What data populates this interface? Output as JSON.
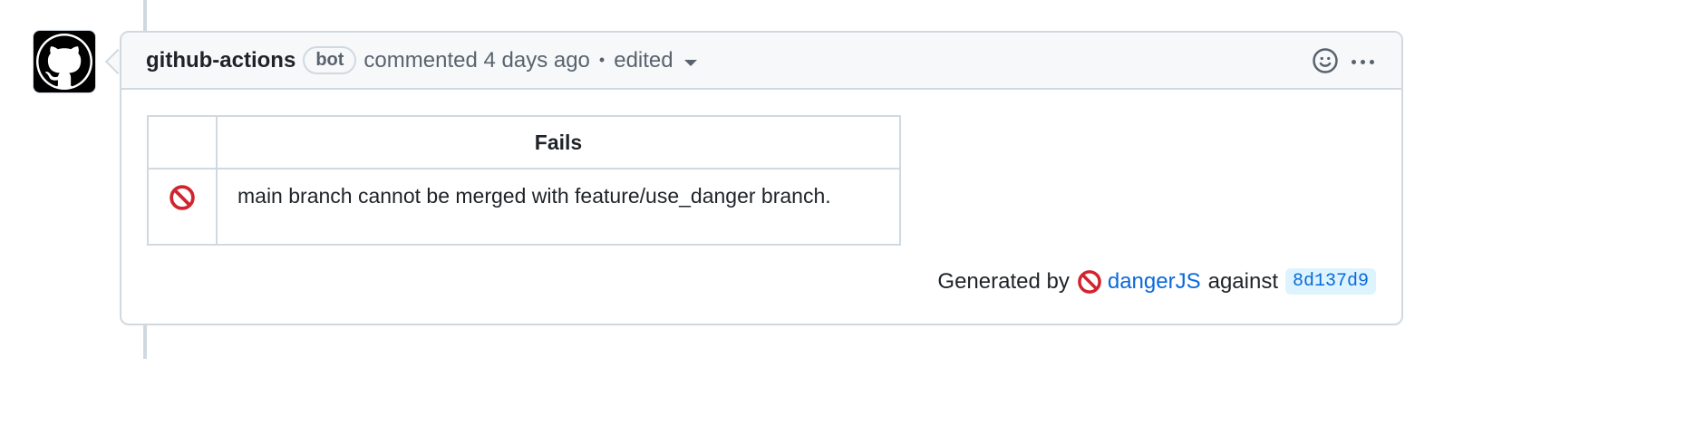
{
  "comment": {
    "author": "github-actions",
    "badge": "bot",
    "action": "commented 4 days ago",
    "separator": "•",
    "edited": "edited"
  },
  "table": {
    "headers": [
      "",
      "Fails"
    ],
    "rows": [
      {
        "icon": "no-entry-icon",
        "message": "main branch cannot be merged with feature/use_danger branch."
      }
    ]
  },
  "footer": {
    "prefix": "Generated by",
    "tool": "dangerJS",
    "against": "against",
    "sha": "8d137d9"
  },
  "colors": {
    "border": "#d1d9e0",
    "header_bg": "#f6f8fa",
    "link": "#0969da",
    "danger": "#d1242f"
  }
}
